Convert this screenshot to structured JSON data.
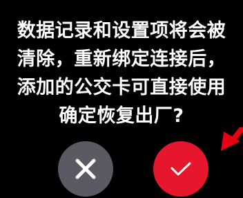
{
  "dialog": {
    "lines": [
      "数据记录和设置项将会被",
      "清除，重新绑定连接后，",
      "添加的公交卡可直接使用",
      "确定恢复出厂?"
    ]
  },
  "buttons": {
    "cancel_icon": "close-icon",
    "confirm_icon": "check-icon"
  },
  "colors": {
    "background": "#000000",
    "text": "#ffffff",
    "cancel_button": "#5a5a63",
    "confirm_button": "#e6162d",
    "annotation_arrow": "#e60012"
  }
}
